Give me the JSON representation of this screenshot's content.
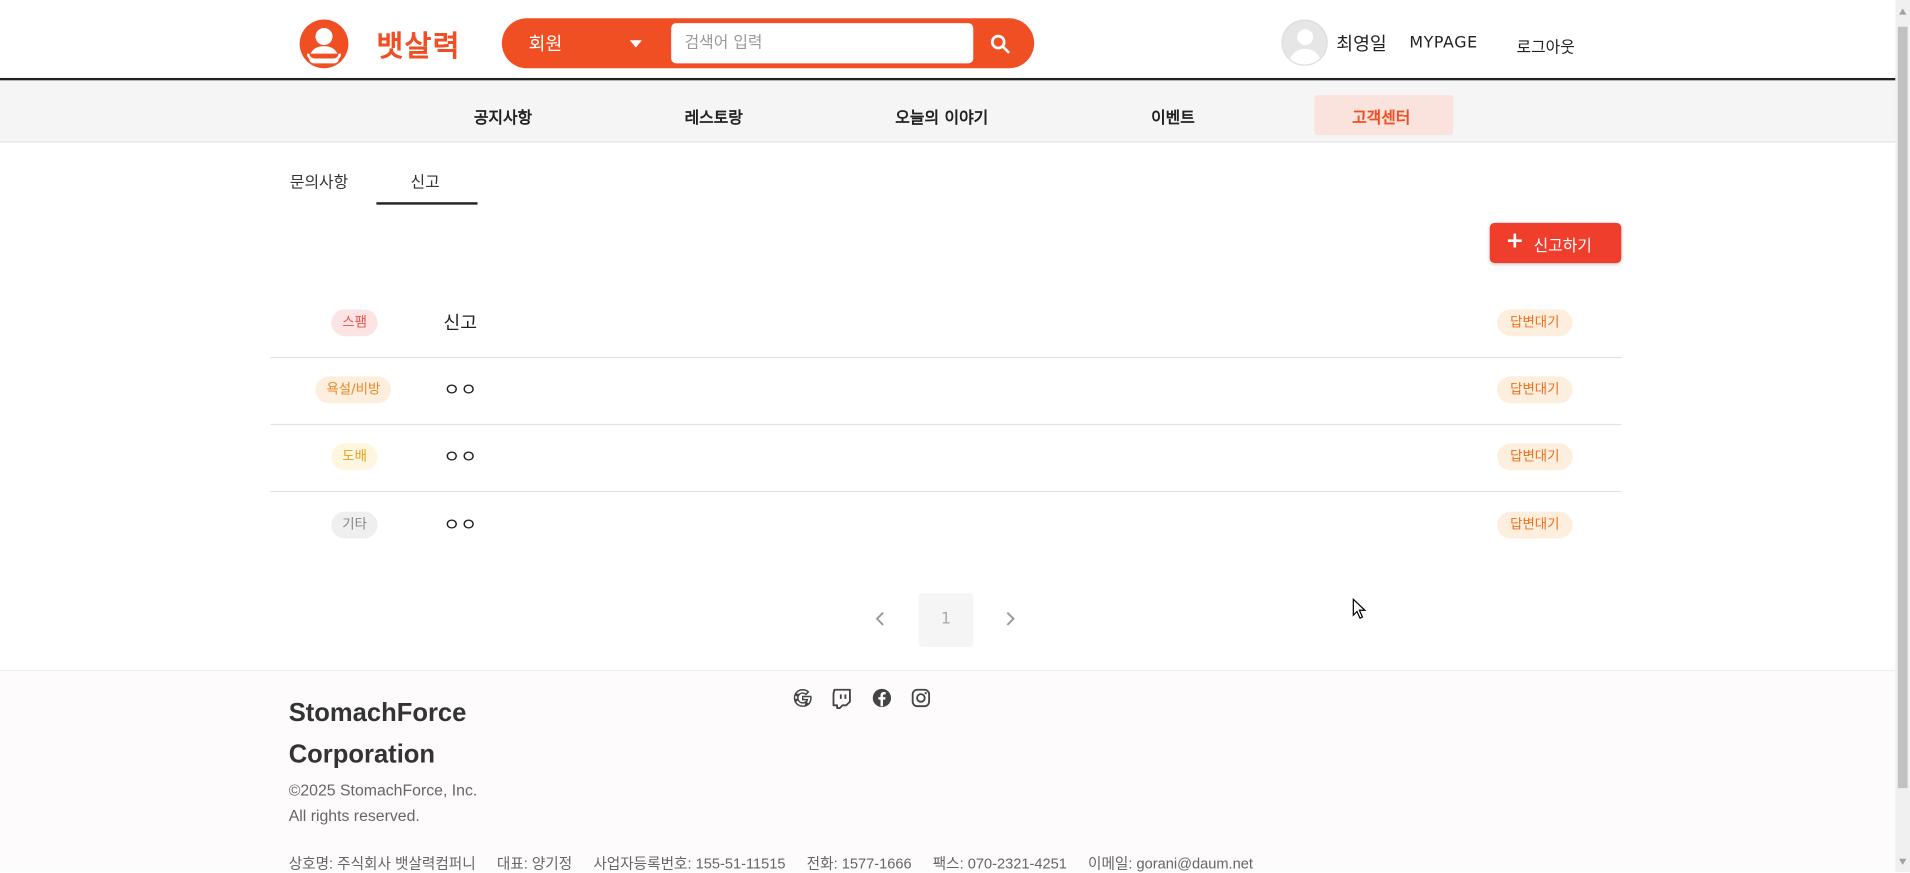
{
  "brand": {
    "name": "뱃살력"
  },
  "search": {
    "category": "회원",
    "placeholder": "검색어 입력"
  },
  "user": {
    "name": "최영일",
    "mypage": "MYPAGE",
    "logout": "로그아웃"
  },
  "nav": {
    "items": [
      {
        "label": "공지사항"
      },
      {
        "label": "레스토랑"
      },
      {
        "label": "오늘의 이야기"
      },
      {
        "label": "이벤트"
      },
      {
        "label": "고객센터",
        "active": true
      }
    ]
  },
  "tabs": [
    {
      "label": "문의사항"
    },
    {
      "label": "신고",
      "active": true
    }
  ],
  "report_button": {
    "label": "신고하기"
  },
  "reports": [
    {
      "category": "스팸",
      "title": "신고",
      "status": "답변대기"
    },
    {
      "category": "욕설/비방",
      "title": "ㅇㅇ",
      "status": "답변대기"
    },
    {
      "category": "도배",
      "title": "ㅇㅇ",
      "status": "답변대기"
    },
    {
      "category": "기타",
      "title": "ㅇㅇ",
      "status": "답변대기"
    }
  ],
  "badge_colors": {
    "spam": {
      "bg": "#fde4e4",
      "fg": "#e8504a"
    },
    "abuse": {
      "bg": "#fdeedd",
      "fg": "#e8871f"
    },
    "flood": {
      "bg": "#fef6de",
      "fg": "#e5a21f"
    },
    "etc": {
      "bg": "#efefef",
      "fg": "#888888"
    }
  },
  "pagination": {
    "current": "1"
  },
  "footer": {
    "company_line1": "StomachForce",
    "company_line2": "Corporation",
    "copyright": "©2025 StomachForce, Inc.",
    "rights": "All rights reserved.",
    "info": [
      "상호명: 주식회사 뱃살력컴퍼니",
      "대표: 양기정",
      "사업자등록번호: 155-51-11515",
      "전화: 1577-1666",
      "팩스: 070-2321-4251",
      "이메일: gorani@daum.net"
    ],
    "social_icons": [
      "google-icon",
      "twitch-icon",
      "facebook-icon",
      "instagram-icon"
    ]
  },
  "colors": {
    "accent": "#f04e23",
    "button": "#ef3e2c"
  }
}
